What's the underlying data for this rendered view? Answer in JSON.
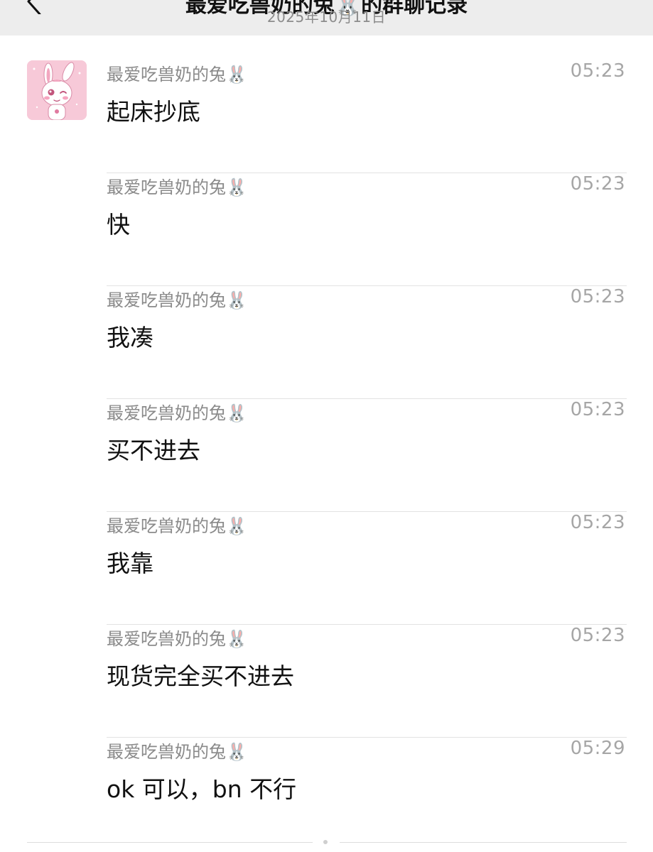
{
  "header": {
    "title": "最爱吃兽奶的兔🐰的群聊记录",
    "date": "2025年10月11日"
  },
  "icons": {
    "back": "chevron-left-icon",
    "more": "more-dots-icon",
    "avatar": "pink-rabbit-avatar"
  },
  "messages": [
    {
      "sender": "最爱吃兽奶的兔🐰",
      "time": "05:23",
      "text": "起床抄底"
    },
    {
      "sender": "最爱吃兽奶的兔🐰",
      "time": "05:23",
      "text": "快"
    },
    {
      "sender": "最爱吃兽奶的兔🐰",
      "time": "05:23",
      "text": "我凑"
    },
    {
      "sender": "最爱吃兽奶的兔🐰",
      "time": "05:23",
      "text": "买不进去"
    },
    {
      "sender": "最爱吃兽奶的兔🐰",
      "time": "05:23",
      "text": "我靠"
    },
    {
      "sender": "最爱吃兽奶的兔🐰",
      "time": "05:23",
      "text": "现货完全买不进去"
    },
    {
      "sender": "最爱吃兽奶的兔🐰",
      "time": "05:29",
      "text": "ok 可以，bn 不行"
    }
  ],
  "colors": {
    "header_bg": "#ededed",
    "avatar_bg": "#f7c9d8",
    "sender_text": "#8a8a8a",
    "time_text": "#a6a6a6",
    "message_text": "#111111",
    "divider": "#e2e2e2"
  }
}
